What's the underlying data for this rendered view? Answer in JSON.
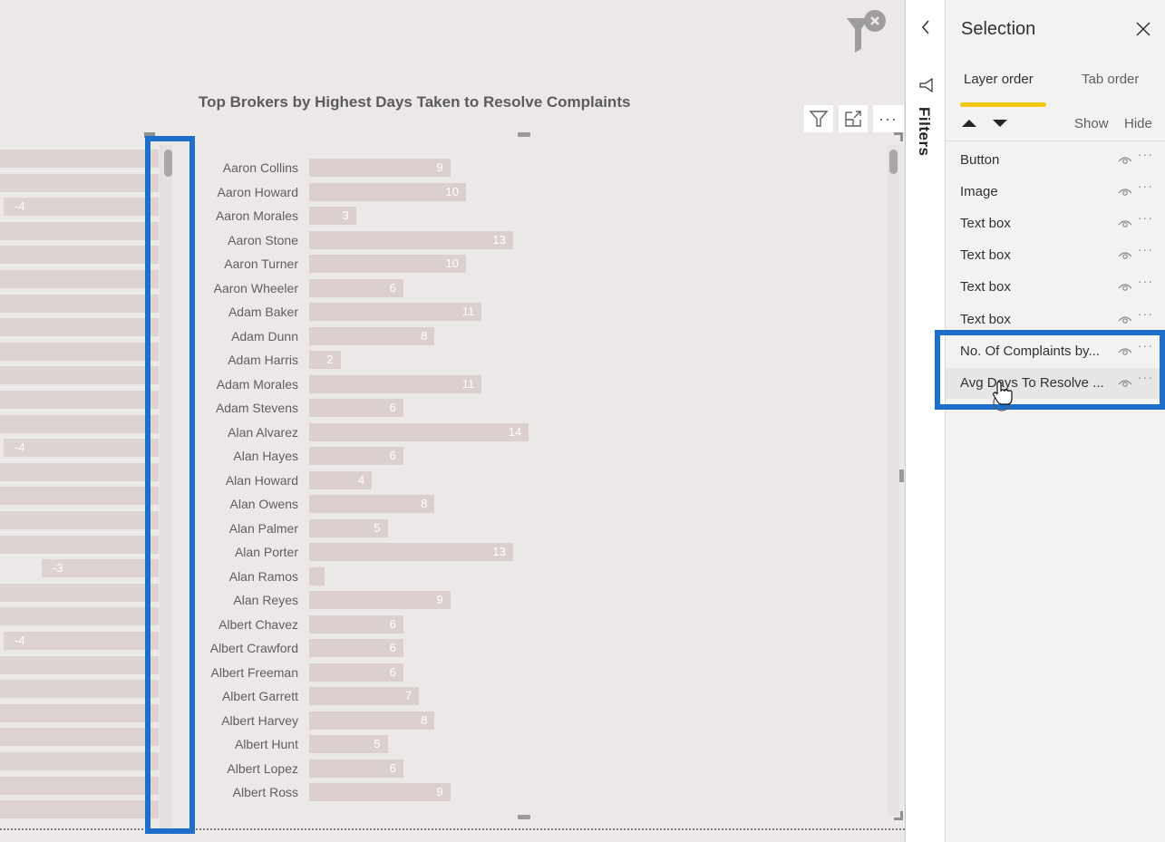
{
  "canvas": {
    "left_chart": {
      "description": "partially visible bar chart (clipped at left edge)",
      "rows": [
        {
          "label": ""
        },
        {
          "label": ""
        },
        {
          "label": "-4"
        },
        {
          "label": ""
        },
        {
          "label": ""
        },
        {
          "label": ""
        },
        {
          "label": ""
        },
        {
          "label": ""
        },
        {
          "label": ""
        },
        {
          "label": ""
        },
        {
          "label": ""
        },
        {
          "label": ""
        },
        {
          "label": "-4"
        },
        {
          "label": ""
        },
        {
          "label": ""
        },
        {
          "label": ""
        },
        {
          "label": ""
        },
        {
          "label": "-3"
        },
        {
          "label": ""
        },
        {
          "label": ""
        },
        {
          "label": "-4"
        },
        {
          "label": ""
        },
        {
          "label": ""
        },
        {
          "label": ""
        },
        {
          "label": ""
        },
        {
          "label": ""
        },
        {
          "label": ""
        },
        {
          "label": ""
        }
      ]
    },
    "visual_header": {
      "filter_icon": "funnel-icon",
      "focus_mode_icon": "focus-mode-icon",
      "more_options": "..."
    },
    "clear_filters_icon": "funnel-clear-icon"
  },
  "chart_data": {
    "type": "bar",
    "orientation": "horizontal",
    "title": "Top Brokers by Highest Days Taken to Resolve Complaints",
    "xlabel": "",
    "ylabel": "",
    "xlim": [
      0,
      14
    ],
    "grid": false,
    "legend": "none",
    "categories": [
      "Aaron Collins",
      "Aaron Howard",
      "Aaron Morales",
      "Aaron Stone",
      "Aaron Turner",
      "Aaron Wheeler",
      "Adam Baker",
      "Adam Dunn",
      "Adam Harris",
      "Adam Morales",
      "Adam Stevens",
      "Alan Alvarez",
      "Alan Hayes",
      "Alan Howard",
      "Alan Owens",
      "Alan Palmer",
      "Alan Porter",
      "Alan Ramos",
      "Alan Reyes",
      "Albert Chavez",
      "Albert Crawford",
      "Albert Freeman",
      "Albert Garrett",
      "Albert Harvey",
      "Albert Hunt",
      "Albert Lopez",
      "Albert Ross"
    ],
    "values": [
      9,
      10,
      3,
      13,
      10,
      6,
      11,
      8,
      2,
      11,
      6,
      14,
      6,
      4,
      8,
      5,
      13,
      1,
      9,
      6,
      6,
      6,
      7,
      8,
      5,
      6,
      9
    ],
    "data_labels": [
      "9",
      "10",
      "3",
      "13",
      "10",
      "6",
      "11",
      "8",
      "2",
      "11",
      "6",
      "14",
      "6",
      "4",
      "8",
      "5",
      "13",
      "",
      "9",
      "6",
      "6",
      "6",
      "7",
      "8",
      "5",
      "6",
      "9"
    ],
    "bar_color": "#dccfd0",
    "label_color": "#ffffff"
  },
  "filters_pane": {
    "label": "Filters",
    "collapse_icon": "chevron-left-icon",
    "funnel_icon": "funnel-icon"
  },
  "selection_pane": {
    "title": "Selection",
    "close_icon": "close-icon",
    "tabs": [
      {
        "label": "Layer order",
        "active": true
      },
      {
        "label": "Tab order",
        "active": false
      }
    ],
    "move_up_icon": "triangle-up-icon",
    "move_down_icon": "triangle-down-icon",
    "show_label": "Show",
    "hide_label": "Hide",
    "layers": [
      {
        "name": "Button"
      },
      {
        "name": "Image"
      },
      {
        "name": "Text box"
      },
      {
        "name": "Text box"
      },
      {
        "name": "Text box"
      },
      {
        "name": "Text box"
      },
      {
        "name": "No. Of Complaints by..."
      },
      {
        "name": "Avg Days To Resolve ..."
      }
    ],
    "more_label": "···",
    "accent_color": "#f2c811"
  },
  "highlight_color": "#1e6fcc"
}
